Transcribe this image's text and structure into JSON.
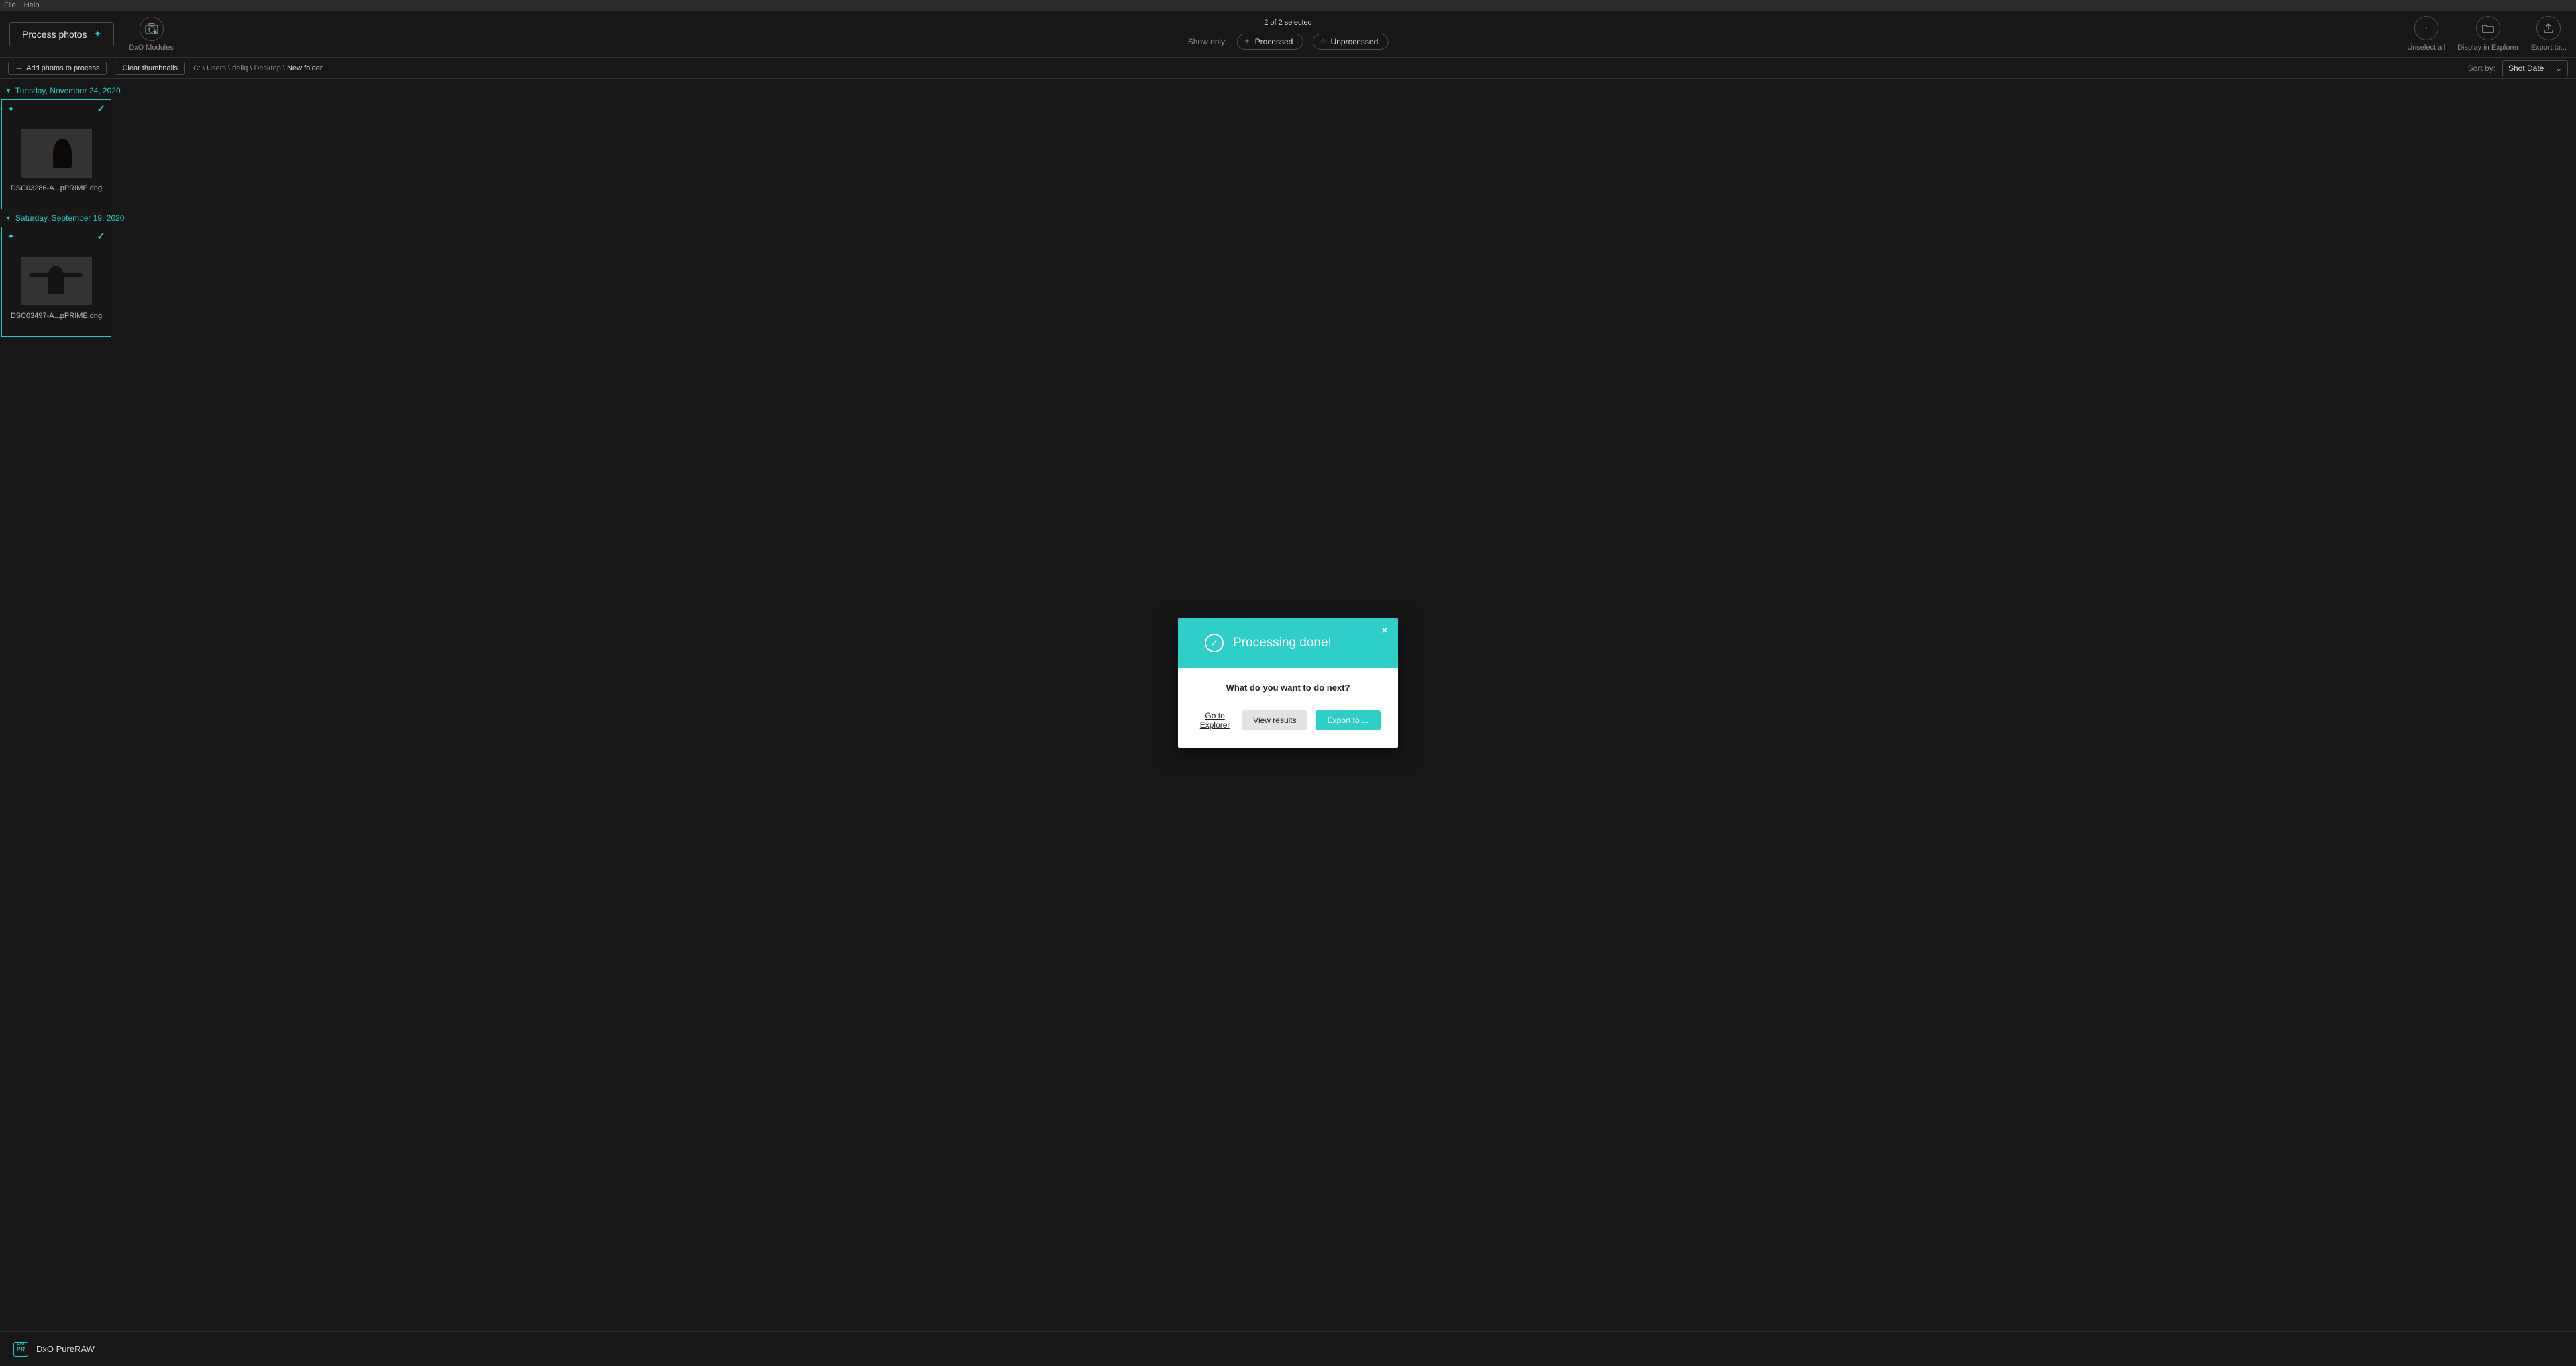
{
  "menu": {
    "file": "File",
    "help": "Help"
  },
  "toolbar": {
    "process_label": "Process photos",
    "modules_label": "DxO Modules",
    "selected_count": "2 of 2 selected",
    "show_only_label": "Show only:",
    "processed_label": "Processed",
    "unprocessed_label": "Unprocessed",
    "unselect_label": "Unselect all",
    "display_explorer_label": "Display in Explorer",
    "export_label": "Export to..."
  },
  "subbar": {
    "add_label": "Add photos to process",
    "clear_label": "Clear thumbnails",
    "breadcrumb_prefix": "C: \\ Users \\ deliq \\ Desktop \\ ",
    "breadcrumb_current": "New folder",
    "sort_label": "Sort by:",
    "sort_value": "Shot Date"
  },
  "groups": [
    {
      "date": "Tuesday, November 24, 2020",
      "thumb": {
        "filename": "DSC03286-A...pPRIME.dng"
      }
    },
    {
      "date": "Saturday, September 19, 2020",
      "thumb": {
        "filename": "DSC03497-A...pPRIME.dng"
      }
    }
  ],
  "bottom": {
    "app_name": "DxO PureRAW",
    "logo_text": "PR"
  },
  "modal": {
    "title": "Processing done!",
    "question": "What do you want to do next?",
    "go_explorer": "Go to Explorer",
    "view_results": "View results",
    "export_to": "Export to ..."
  }
}
